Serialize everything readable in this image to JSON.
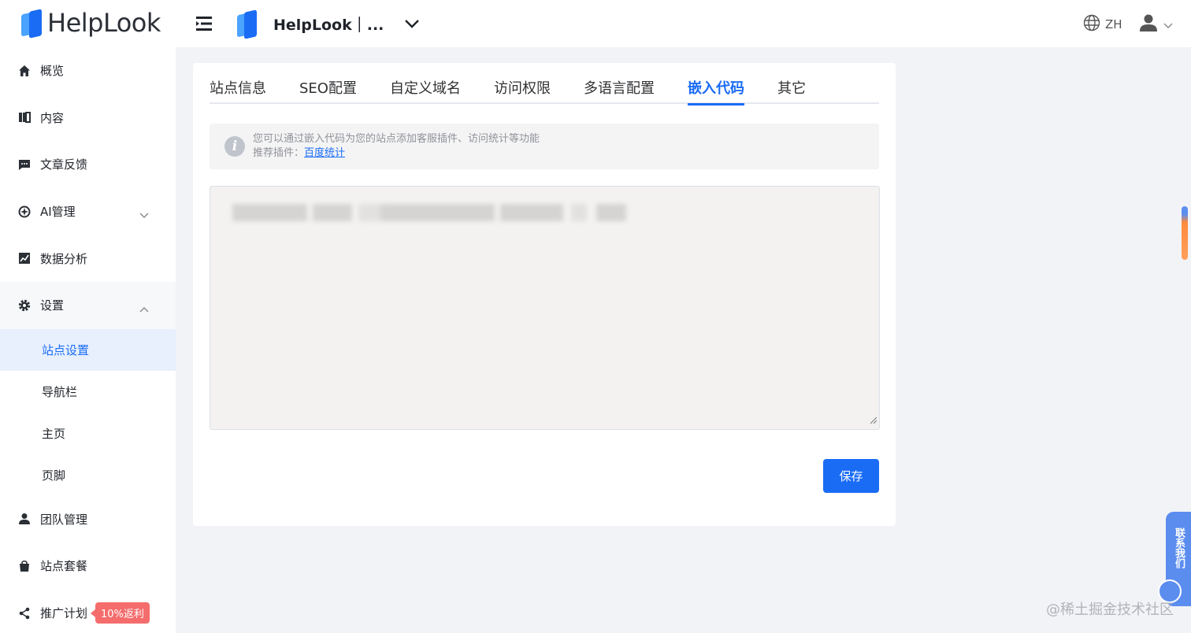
{
  "app": {
    "logo_text": "HelpLook"
  },
  "header": {
    "site_name": "HelpLook｜...",
    "lang_label": "ZH"
  },
  "sidebar": {
    "items": [
      {
        "label": "概览",
        "icon": "home-icon"
      },
      {
        "label": "内容",
        "icon": "book-icon"
      },
      {
        "label": "文章反馈",
        "icon": "message-icon"
      },
      {
        "label": "AI管理",
        "icon": "ai-icon"
      },
      {
        "label": "数据分析",
        "icon": "chart-icon"
      },
      {
        "label": "设置",
        "icon": "gear-icon"
      },
      {
        "label": "团队管理",
        "icon": "user-icon"
      },
      {
        "label": "站点套餐",
        "icon": "bag-icon"
      },
      {
        "label": "推广计划",
        "icon": "share-icon"
      }
    ],
    "settings_sub": [
      "站点设置",
      "导航栏",
      "主页",
      "页脚"
    ],
    "promo_badge": "10%返利"
  },
  "tabs": [
    "站点信息",
    "SEO配置",
    "自定义域名",
    "访问权限",
    "多语言配置",
    "嵌入代码",
    "其它"
  ],
  "active_tab": "嵌入代码",
  "info": {
    "line1": "您可以通过嵌入代码为您的站点添加客服插件、访问统计等功能",
    "line2_prefix": "推荐插件：",
    "line2_link": "百度统计"
  },
  "actions": {
    "save_label": "保存"
  },
  "contact": {
    "label": "联系我们"
  },
  "watermark": "@稀土掘金技术社区",
  "colors": {
    "accent": "#1a6cf5",
    "badge": "#f56c6c",
    "active_bg": "#e8f0fe"
  }
}
